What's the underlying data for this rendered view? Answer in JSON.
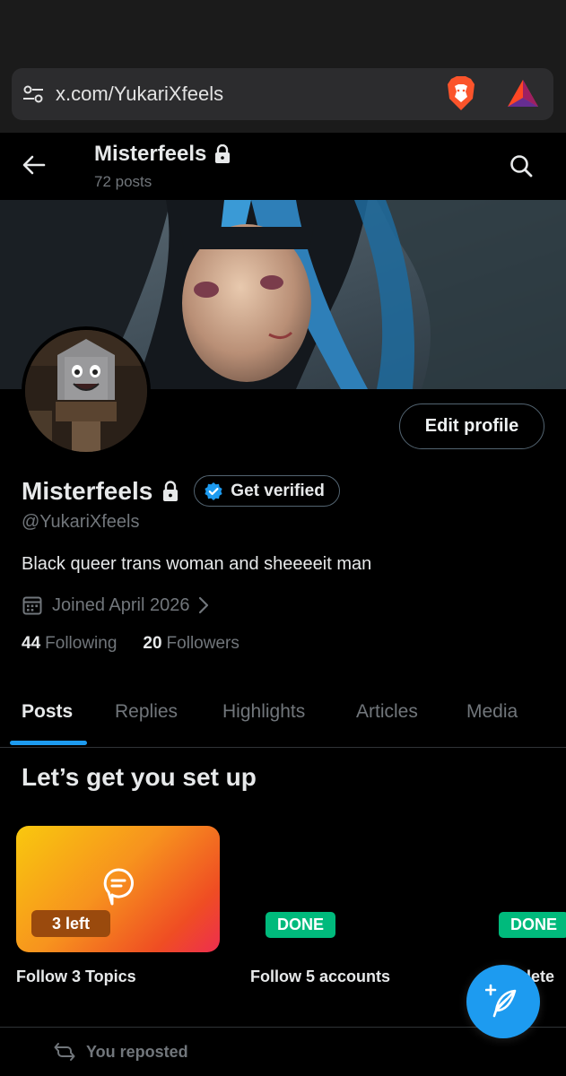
{
  "browser": {
    "url": "x.com/YukariXfeels",
    "icons": [
      "site-settings-icon",
      "brave-lion-icon",
      "bat-rewards-icon"
    ]
  },
  "header": {
    "title": "Misterfeels",
    "posts_count": "72 posts",
    "icons": [
      "back-arrow-icon",
      "lock-icon",
      "search-icon"
    ]
  },
  "profile": {
    "display_name": "Misterfeels",
    "verified_label": "Get verified",
    "handle": "@YukariXfeels",
    "bio": "Black queer trans woman and sheeeeit man",
    "joined": "Joined April 2026",
    "edit_label": "Edit profile",
    "following_count": "44",
    "following_label": "Following",
    "followers_count": "20",
    "followers_label": "Followers"
  },
  "tabs": [
    {
      "label": "Posts",
      "active": true
    },
    {
      "label": "Replies",
      "active": false
    },
    {
      "label": "Highlights",
      "active": false
    },
    {
      "label": "Articles",
      "active": false
    },
    {
      "label": "Media",
      "active": false
    }
  ],
  "setup": {
    "title": "Let’s get you set up",
    "cards": [
      {
        "badge": "3 left",
        "label": "Follow 3 Topics",
        "icon": "topic-chat-icon"
      },
      {
        "badge": "DONE",
        "label": "Follow 5 accounts"
      },
      {
        "badge": "DONE",
        "label": "plete"
      }
    ]
  },
  "feed": {
    "repost_label": "You reposted"
  },
  "colors": {
    "accent": "#1d9bf0",
    "done_green": "#00ba7c",
    "muted_text": "#71767b",
    "background": "#000000"
  }
}
